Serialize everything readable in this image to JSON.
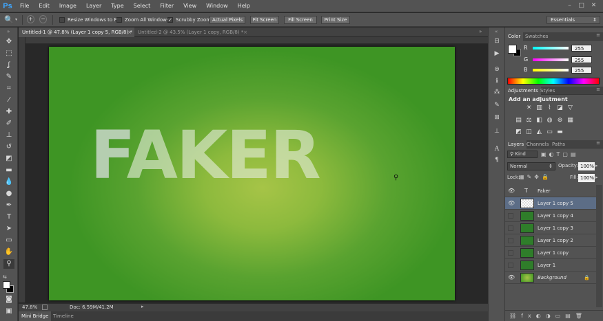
{
  "app": {
    "logo": "Ps"
  },
  "menu": [
    "File",
    "Edit",
    "Image",
    "Layer",
    "Type",
    "Select",
    "Filter",
    "View",
    "Window",
    "Help"
  ],
  "window_controls": [
    "–",
    "□",
    "✕"
  ],
  "options": {
    "checkboxes": [
      {
        "label": "Resize Windows to Fit",
        "checked": false
      },
      {
        "label": "Zoom All Windows",
        "checked": false
      },
      {
        "label": "Scrubby Zoom",
        "checked": true
      }
    ],
    "buttons": [
      "Actual Pixels",
      "Fit Screen",
      "Fill Screen",
      "Print Size"
    ],
    "workspace": "Essentials"
  },
  "doc_tabs": [
    {
      "title": "Untitled-1 @ 47.8% (Layer 1 copy 5, RGB/8) *",
      "active": true
    },
    {
      "title": "Untitled-2 @ 43.5% (Layer 1 copy, RGB/8) *",
      "active": false
    }
  ],
  "canvas": {
    "text": "FAKER"
  },
  "status": {
    "zoom": "47.8%",
    "doc": "Doc: 6.59M/41.2M"
  },
  "bottom_tabs": [
    "Mini Bridge",
    "Timeline"
  ],
  "color_panel": {
    "tabs": [
      "Color",
      "Swatches"
    ],
    "channels": [
      {
        "label": "R",
        "value": "255"
      },
      {
        "label": "G",
        "value": "255"
      },
      {
        "label": "B",
        "value": "255"
      }
    ]
  },
  "adjustments_panel": {
    "tabs": [
      "Adjustments",
      "Styles"
    ],
    "title": "Add an adjustment"
  },
  "layers_panel": {
    "tabs": [
      "Layers",
      "Channels",
      "Paths"
    ],
    "filter": "Kind",
    "blend_mode": "Normal",
    "opacity_label": "Opacity:",
    "opacity": "100%",
    "lock_label": "Lock:",
    "fill_label": "Fill:",
    "fill": "100%",
    "layers": [
      {
        "name": "Faker",
        "type": "text",
        "visible": true,
        "selected": false
      },
      {
        "name": "Layer 1 copy 5",
        "type": "transparent",
        "visible": true,
        "selected": true
      },
      {
        "name": "Layer 1 copy 4",
        "type": "leaf",
        "visible": false,
        "selected": false
      },
      {
        "name": "Layer 1 copy 3",
        "type": "leaf",
        "visible": false,
        "selected": false
      },
      {
        "name": "Layer 1 copy 2",
        "type": "leaf",
        "visible": false,
        "selected": false
      },
      {
        "name": "Layer 1 copy",
        "type": "leaf",
        "visible": false,
        "selected": false
      },
      {
        "name": "Layer 1",
        "type": "leaf",
        "visible": false,
        "selected": false
      },
      {
        "name": "Background",
        "type": "background",
        "visible": true,
        "selected": false
      }
    ]
  },
  "colors": {
    "accent": "#3fa7ff",
    "canvas_center": "#a6c447",
    "canvas_edge": "#3e9524",
    "selected_layer": "#5c6d86"
  }
}
